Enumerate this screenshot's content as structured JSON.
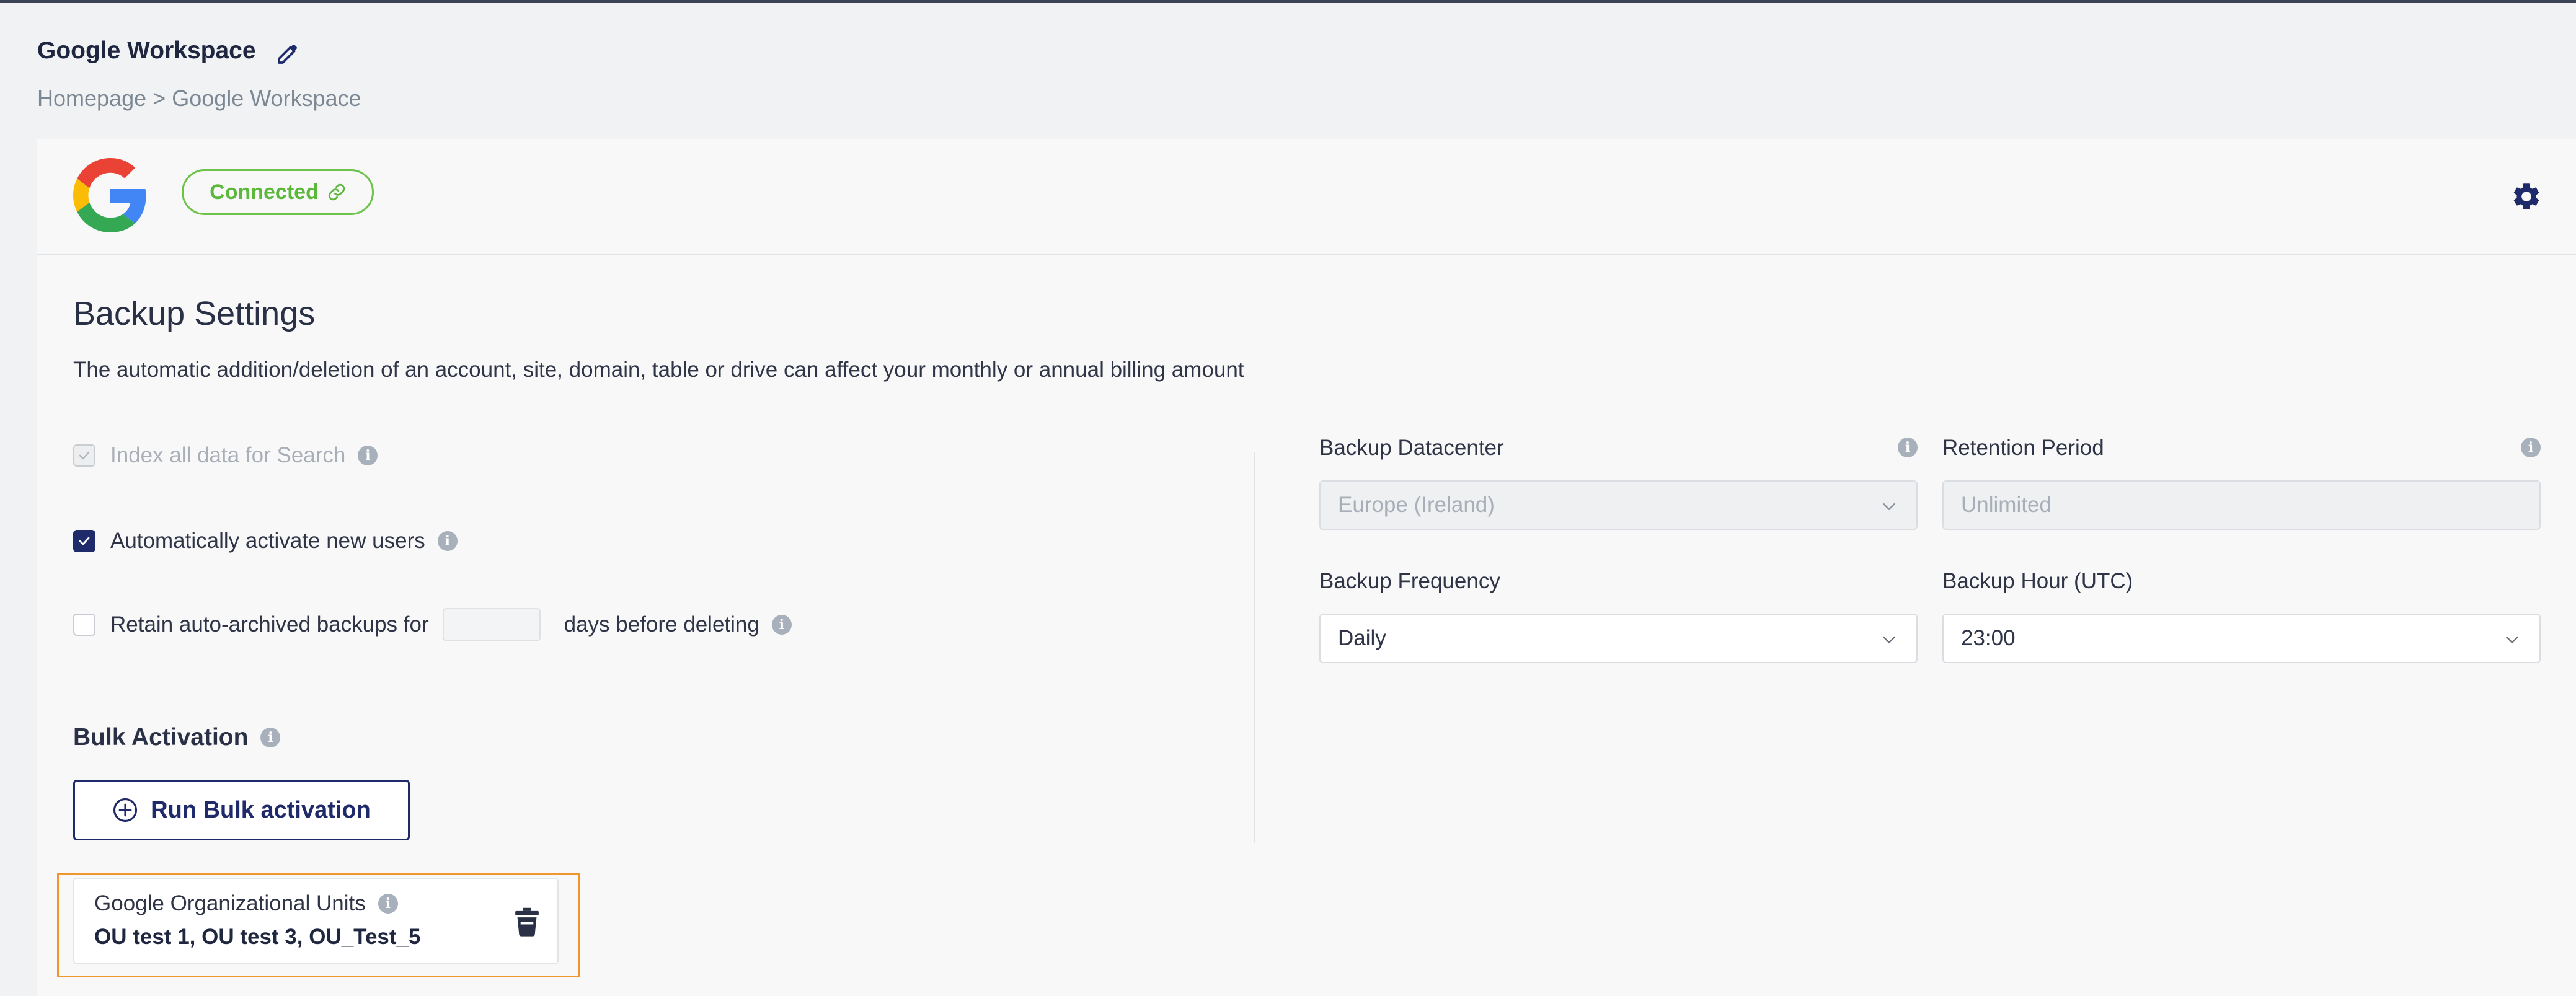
{
  "page": {
    "title": "Google Workspace",
    "breadcrumb": {
      "home": "Homepage",
      "separator": ">",
      "current": "Google Workspace"
    }
  },
  "header": {
    "status_label": "Connected",
    "status_color": "#5cb83a"
  },
  "backup_settings": {
    "title": "Backup Settings",
    "description": "The automatic addition/deletion of an account, site, domain, table or drive can affect your monthly or annual billing amount",
    "options": {
      "index_label": "Index all data for Search",
      "index_checked": true,
      "index_disabled": true,
      "auto_activate_label": "Automatically activate new users",
      "auto_activate_checked": true,
      "retain_label": "Retain auto-archived backups for",
      "retain_checked": false,
      "retain_days_value": "",
      "retain_suffix": "days before deleting"
    },
    "fields": {
      "datacenter_label": "Backup Datacenter",
      "datacenter_value": "Europe (Ireland)",
      "retention_label": "Retention Period",
      "retention_value": "Unlimited",
      "frequency_label": "Backup Frequency",
      "frequency_value": "Daily",
      "hour_label": "Backup Hour (UTC)",
      "hour_value": "23:00"
    }
  },
  "bulk": {
    "title": "Bulk Activation",
    "run_button": "Run Bulk activation",
    "ou_label": "Google Organizational Units",
    "ou_value": "OU test 1, OU test 3, OU_Test_5"
  },
  "colors": {
    "accent": "#1f2a6b",
    "highlight_outline": "#f0962d",
    "connected_border": "#6cc24a"
  }
}
